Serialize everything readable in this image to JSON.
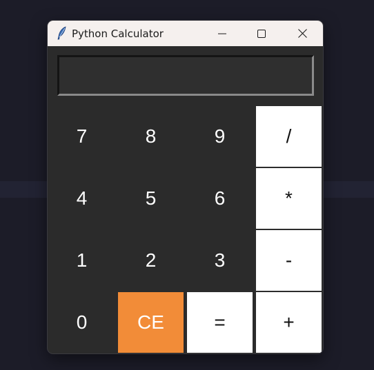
{
  "window": {
    "title": "Python Calculator"
  },
  "display": {
    "value": ""
  },
  "keys": {
    "k7": "7",
    "k8": "8",
    "k9": "9",
    "div": "/",
    "k4": "4",
    "k5": "5",
    "k6": "6",
    "mul": "*",
    "k1": "1",
    "k2": "2",
    "k3": "3",
    "sub": "-",
    "k0": "0",
    "ce": "CE",
    "eq": "=",
    "add": "+"
  },
  "icons": {
    "app": "feather-icon",
    "minimize": "minimize-icon",
    "maximize": "maximize-icon",
    "close": "close-icon"
  },
  "colors": {
    "window_bg": "#2b2b2b",
    "operator_bg": "#ffffff",
    "clear_bg": "#f28c38",
    "titlebar_bg": "#f5f0ee"
  }
}
